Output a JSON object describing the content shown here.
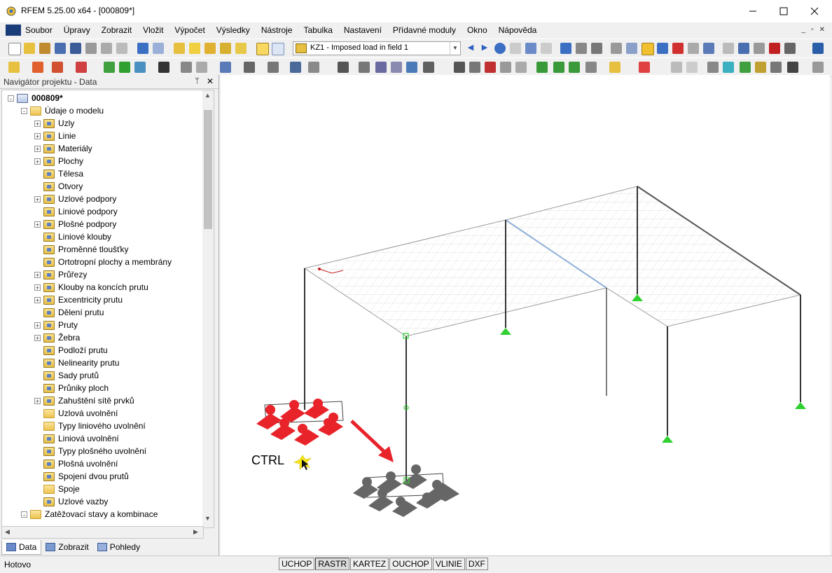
{
  "window": {
    "title": "RFEM 5.25.00 x64 - [000809*]",
    "controls": {
      "minimize": "–",
      "maximize": "□",
      "close": "✕"
    }
  },
  "menubar": {
    "items": [
      "Soubor",
      "Úpravy",
      "Zobrazit",
      "Vložit",
      "Výpočet",
      "Výsledky",
      "Nástroje",
      "Tabulka",
      "Nastavení",
      "Přídavné moduly",
      "Okno",
      "Nápověda"
    ],
    "mdi_controls": [
      "_",
      "▫",
      "✕"
    ]
  },
  "toolbar": {
    "load_case_select": {
      "value": "KZ1 - Imposed load in field 1"
    },
    "icons": [
      "new-icon",
      "open-icon",
      "save-icon",
      "print-icon",
      "undo-icon",
      "redo-icon",
      "select-icon",
      "zoom-icon",
      "navigator-icon",
      "table-icon",
      "previous-icon",
      "next-icon",
      "results-icon",
      "display-icon",
      "view-icon",
      "render-icon"
    ]
  },
  "navigator": {
    "title": "Navigátor projektu - Data",
    "pin": "ᛘ",
    "close": "✕",
    "tree": [
      {
        "label": "000809*",
        "level": 0,
        "expander": "-",
        "icon": "root",
        "bold": true
      },
      {
        "label": "Údaje o modelu",
        "level": 1,
        "expander": "-",
        "icon": "folder"
      },
      {
        "label": "Uzly",
        "level": 2,
        "expander": "+",
        "icon": "item"
      },
      {
        "label": "Linie",
        "level": 2,
        "expander": "+",
        "icon": "item"
      },
      {
        "label": "Materiály",
        "level": 2,
        "expander": "+",
        "icon": "item"
      },
      {
        "label": "Plochy",
        "level": 2,
        "expander": "+",
        "icon": "item"
      },
      {
        "label": "Tělesa",
        "level": 2,
        "expander": "",
        "icon": "item"
      },
      {
        "label": "Otvory",
        "level": 2,
        "expander": "",
        "icon": "item"
      },
      {
        "label": "Uzlové podpory",
        "level": 2,
        "expander": "+",
        "icon": "item"
      },
      {
        "label": "Liniové podpory",
        "level": 2,
        "expander": "",
        "icon": "item"
      },
      {
        "label": "Plošné podpory",
        "level": 2,
        "expander": "+",
        "icon": "item"
      },
      {
        "label": "Liniové klouby",
        "level": 2,
        "expander": "",
        "icon": "item"
      },
      {
        "label": "Proměnné tloušťky",
        "level": 2,
        "expander": "",
        "icon": "item"
      },
      {
        "label": "Ortotropní plochy a membrány",
        "level": 2,
        "expander": "",
        "icon": "item"
      },
      {
        "label": "Průřezy",
        "level": 2,
        "expander": "+",
        "icon": "item"
      },
      {
        "label": "Klouby na koncích prutu",
        "level": 2,
        "expander": "+",
        "icon": "item"
      },
      {
        "label": "Excentricity prutu",
        "level": 2,
        "expander": "+",
        "icon": "item"
      },
      {
        "label": "Dělení prutu",
        "level": 2,
        "expander": "",
        "icon": "item"
      },
      {
        "label": "Pruty",
        "level": 2,
        "expander": "+",
        "icon": "item"
      },
      {
        "label": "Žebra",
        "level": 2,
        "expander": "+",
        "icon": "item"
      },
      {
        "label": "Podloží prutu",
        "level": 2,
        "expander": "",
        "icon": "item"
      },
      {
        "label": "Nelinearity prutu",
        "level": 2,
        "expander": "",
        "icon": "item"
      },
      {
        "label": "Sady prutů",
        "level": 2,
        "expander": "",
        "icon": "item"
      },
      {
        "label": "Průniky ploch",
        "level": 2,
        "expander": "",
        "icon": "item"
      },
      {
        "label": "Zahuštění sítě prvků",
        "level": 2,
        "expander": "+",
        "icon": "item"
      },
      {
        "label": "Uzlová uvolnění",
        "level": 2,
        "expander": "",
        "icon": "folder"
      },
      {
        "label": "Typy liniového uvolnění",
        "level": 2,
        "expander": "",
        "icon": "folder"
      },
      {
        "label": "Liniová uvolnění",
        "level": 2,
        "expander": "",
        "icon": "item"
      },
      {
        "label": "Typy plošného uvolnění",
        "level": 2,
        "expander": "",
        "icon": "item"
      },
      {
        "label": "Plošná uvolnění",
        "level": 2,
        "expander": "",
        "icon": "item"
      },
      {
        "label": "Spojení dvou prutů",
        "level": 2,
        "expander": "",
        "icon": "item"
      },
      {
        "label": "Spoje",
        "level": 2,
        "expander": "",
        "icon": "folder"
      },
      {
        "label": "Uzlové vazby",
        "level": 2,
        "expander": "",
        "icon": "item"
      },
      {
        "label": "Zatěžovací stavy a kombinace",
        "level": 1,
        "expander": "-",
        "icon": "folder"
      }
    ],
    "tabs": [
      "Data",
      "Zobrazit",
      "Pohledy"
    ]
  },
  "viewport": {
    "annotation": "CTRL",
    "colors": {
      "support_green": "#2fd02f",
      "support_red": "#e8232a",
      "support_gray": "#666666",
      "mesh": "#bcbcbc",
      "arrow": "#e8232a"
    }
  },
  "statusbar": {
    "ready": "Hotovo",
    "toggles": [
      "UCHOP",
      "RASTR",
      "KARTEZ",
      "OUCHOP",
      "VLINIE",
      "DXF"
    ],
    "active_toggle": "RASTR"
  }
}
